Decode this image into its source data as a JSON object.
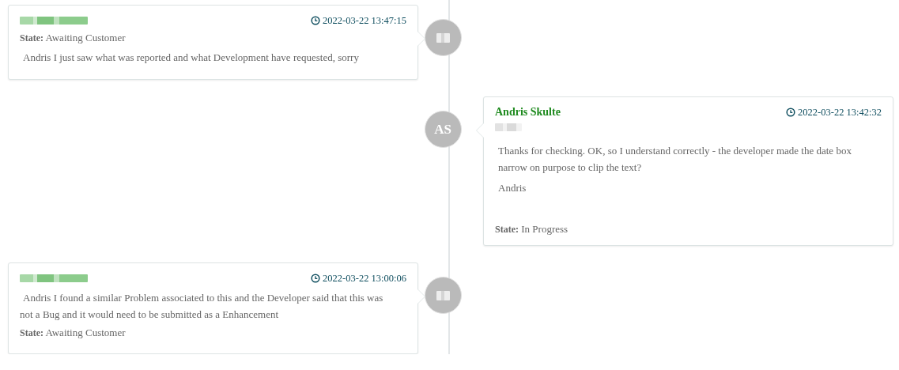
{
  "entries": [
    {
      "kind": "left",
      "author": {
        "redacted": true
      },
      "avatar": {
        "redacted": true
      },
      "timestamp": "2022-03-22 13:47:15",
      "blocks": [
        {
          "kind": "state",
          "text": "**State:** Awaiting Customer"
        },
        {
          "kind": "text",
          "text": "Andris I just saw what was reported and what Development have requested, sorry"
        }
      ]
    },
    {
      "kind": "right",
      "author": {
        "redacted": false,
        "name": "Andris Skulte"
      },
      "avatar": {
        "redacted": false,
        "initials": "AS"
      },
      "timestamp": "2022-03-22 13:42:32",
      "blocks": [
        {
          "kind": "redacted"
        },
        {
          "kind": "text",
          "text": "Thanks for checking. OK, so I understand correctly - the developer made the date box narrow on purpose to clip the text?"
        },
        {
          "kind": "text",
          "text": "Andris"
        },
        {
          "kind": "state",
          "text": "**State:** In Progress"
        }
      ]
    },
    {
      "kind": "left",
      "author": {
        "redacted": true
      },
      "avatar": {
        "redacted": true
      },
      "timestamp": "2022-03-22 13:00:06",
      "blocks": [
        {
          "kind": "text",
          "text": "Andris I found a similar Problem associated to this and the Developer said that this was not a Bug and it would need to be submitted as a Enhancement"
        },
        {
          "kind": "state",
          "text": "**State:** Awaiting Customer"
        }
      ]
    }
  ]
}
